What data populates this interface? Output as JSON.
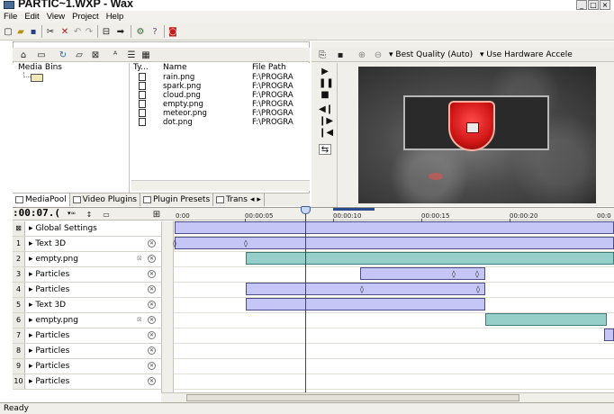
{
  "window": {
    "title": "PARTIC~1.WXP - Wax",
    "buttons": [
      "_",
      "□",
      "×"
    ]
  },
  "menu": [
    "File",
    "Edit",
    "View",
    "Project",
    "Help"
  ],
  "toolbar": {
    "icons": [
      "new-file-icon",
      "open-folder-icon",
      "save-icon",
      "cut-icon",
      "delete-icon",
      "undo-icon",
      "redo-icon",
      "export-icon",
      "arrow-right-icon",
      "settings-icon",
      "help-icon",
      "record-icon"
    ]
  },
  "media_pool": {
    "bins_header": "Media Bins",
    "columns": {
      "type": "Ty...",
      "name": "Name",
      "path": "File Path"
    },
    "files": [
      {
        "name": "rain.png",
        "path": "F:\\PROGRA"
      },
      {
        "name": "spark.png",
        "path": "F:\\PROGRA"
      },
      {
        "name": "cloud.png",
        "path": "F:\\PROGRA"
      },
      {
        "name": "empty.png",
        "path": "F:\\PROGRA"
      },
      {
        "name": "meteor.png",
        "path": "F:\\PROGRA"
      },
      {
        "name": "dot.png",
        "path": "F:\\PROGRA"
      }
    ],
    "tabs": [
      "MediaPool",
      "Video Plugins",
      "Plugin Presets",
      "Trans"
    ]
  },
  "preview": {
    "quality": "Best Quality (Auto)",
    "hardware": "Use Hardware Accele"
  },
  "timeline": {
    "timecode": ":00:07.(",
    "ruler_labels": [
      "0:00",
      "00:00:05",
      "00:00:10",
      "00:00:15",
      "00:00:20",
      "00:0"
    ],
    "tracks": [
      {
        "num": "",
        "label": "Global Settings"
      },
      {
        "num": "1",
        "label": "Text 3D"
      },
      {
        "num": "2",
        "label": "empty.png"
      },
      {
        "num": "3",
        "label": "Particles"
      },
      {
        "num": "4",
        "label": "Particles"
      },
      {
        "num": "5",
        "label": "Text 3D"
      },
      {
        "num": "6",
        "label": "empty.png"
      },
      {
        "num": "7",
        "label": "Particles"
      },
      {
        "num": "8",
        "label": "Particles"
      },
      {
        "num": "9",
        "label": "Particles"
      },
      {
        "num": "10",
        "label": "Particles"
      }
    ],
    "playhead_seconds": 7.0
  },
  "status": "Ready",
  "colors": {
    "effect_clip": "#c6c6f6",
    "image_clip": "#96cfca",
    "badge": "#d11616"
  }
}
